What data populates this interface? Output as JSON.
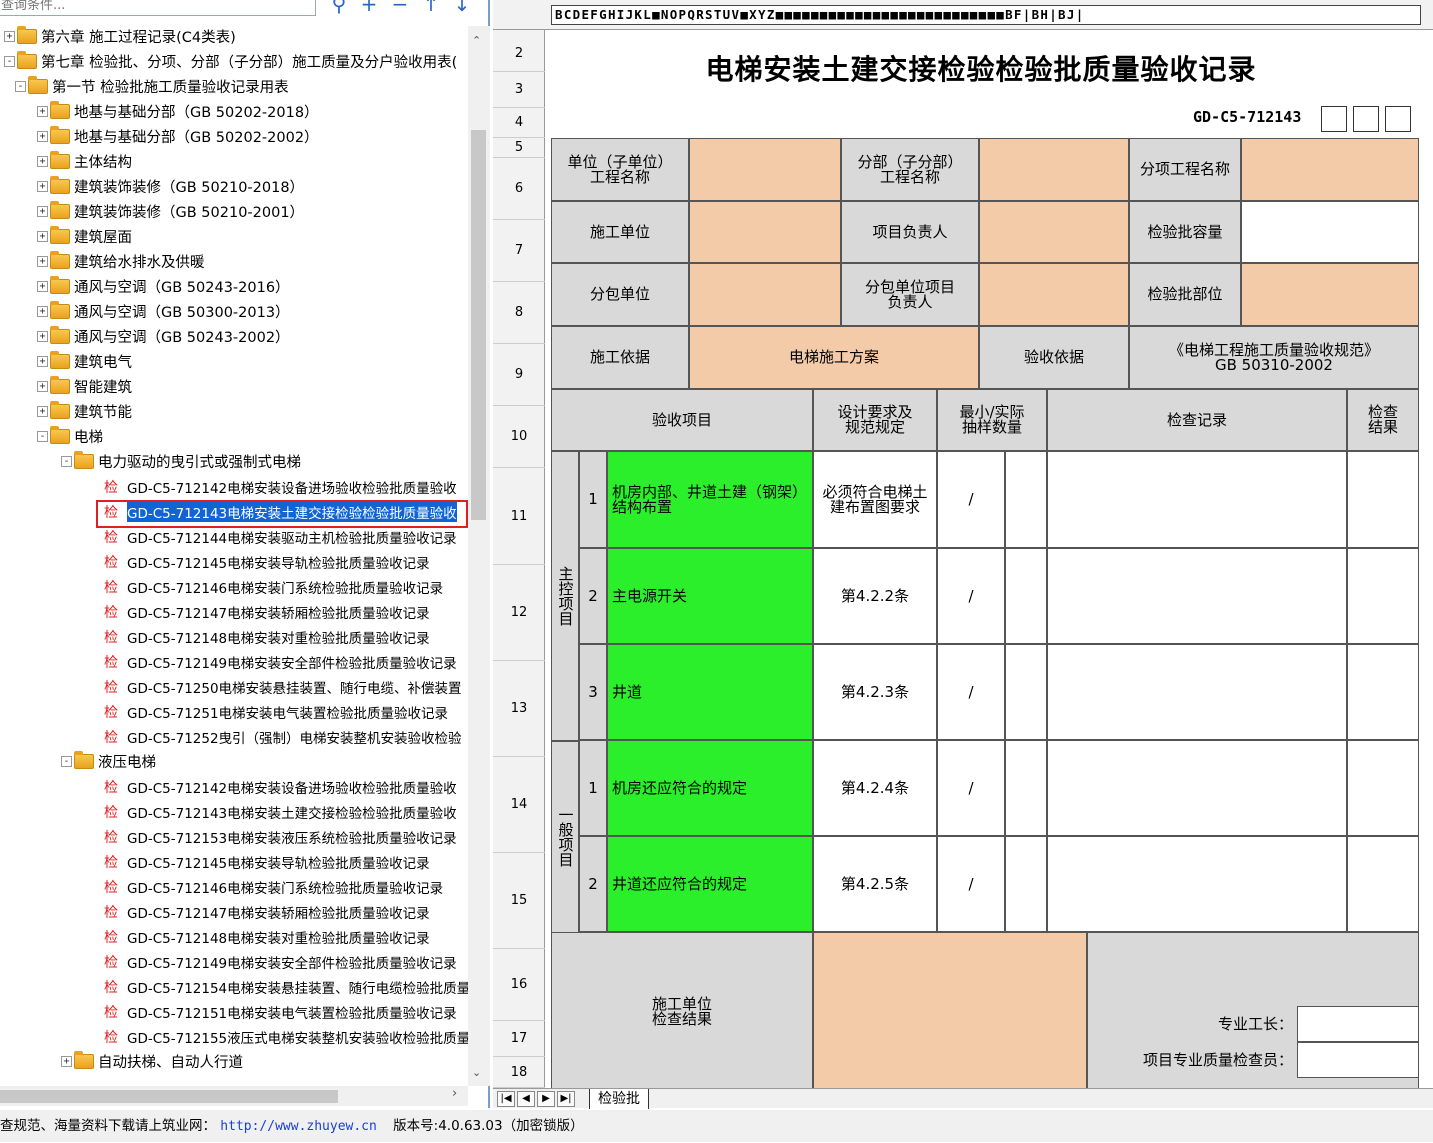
{
  "search": {
    "placeholder": "查询条件..."
  },
  "toolbar_icons": [
    "search-icon",
    "add-icon",
    "minus-icon",
    "arrow-up-icon",
    "arrow-down-icon"
  ],
  "tree": [
    {
      "label": "第六章  施工过程记录(C4类表)",
      "exp": "+",
      "lvl": 0
    },
    {
      "label": "第七章  检验批、分项、分部（子分部）施工质量及分户验收用表(",
      "exp": "-",
      "lvl": 0
    },
    {
      "label": "第一节  检验批施工质量验收记录用表",
      "exp": "-",
      "lvl": 1
    },
    {
      "label": "地基与基础分部（GB 50202-2018）",
      "exp": "+",
      "lvl": 2
    },
    {
      "label": "地基与基础分部（GB 50202-2002）",
      "exp": "+",
      "lvl": 2
    },
    {
      "label": "主体结构",
      "exp": "+",
      "lvl": 2
    },
    {
      "label": "建筑装饰装修（GB 50210-2018）",
      "exp": "+",
      "lvl": 2
    },
    {
      "label": "建筑装饰装修（GB 50210-2001）",
      "exp": "+",
      "lvl": 2
    },
    {
      "label": "建筑屋面",
      "exp": "+",
      "lvl": 2
    },
    {
      "label": "建筑给水排水及供暖",
      "exp": "+",
      "lvl": 2
    },
    {
      "label": "通风与空调（GB 50243-2016）",
      "exp": "+",
      "lvl": 2
    },
    {
      "label": "通风与空调（GB 50300-2013）",
      "exp": "+",
      "lvl": 2
    },
    {
      "label": "通风与空调（GB 50243-2002）",
      "exp": "+",
      "lvl": 2
    },
    {
      "label": "建筑电气",
      "exp": "+",
      "lvl": 2
    },
    {
      "label": "智能建筑",
      "exp": "+",
      "lvl": 2
    },
    {
      "label": "建筑节能",
      "exp": "+",
      "lvl": 2
    },
    {
      "label": "电梯",
      "exp": "-",
      "lvl": 2
    },
    {
      "label": "电力驱动的曳引式或强制式电梯",
      "exp": "-",
      "lvl": 3
    },
    {
      "label": "GD-C5-712142电梯安装设备进场验收检验批质量验收",
      "leaf": true
    },
    {
      "label": "GD-C5-712143电梯安装土建交接检验检验批质量验收",
      "leaf": true,
      "selected": true
    },
    {
      "label": "GD-C5-712144电梯安装驱动主机检验批质量验收记录",
      "leaf": true
    },
    {
      "label": "GD-C5-712145电梯安装导轨检验批质量验收记录",
      "leaf": true
    },
    {
      "label": "GD-C5-712146电梯安装门系统检验批质量验收记录",
      "leaf": true
    },
    {
      "label": "GD-C5-712147电梯安装轿厢检验批质量验收记录",
      "leaf": true
    },
    {
      "label": "GD-C5-712148电梯安装对重检验批质量验收记录",
      "leaf": true
    },
    {
      "label": "GD-C5-712149电梯安装安全部件检验批质量验收记录",
      "leaf": true
    },
    {
      "label": "GD-C5-71250电梯安装悬挂装置、随行电缆、补偿装置",
      "leaf": true
    },
    {
      "label": "GD-C5-71251电梯安装电气装置检验批质量验收记录",
      "leaf": true
    },
    {
      "label": "GD-C5-71252曳引（强制）电梯安装整机安装验收检验",
      "leaf": true
    },
    {
      "label": "液压电梯",
      "exp": "-",
      "lvl": 3
    },
    {
      "label": "GD-C5-712142电梯安装设备进场验收检验批质量验收",
      "leaf": true
    },
    {
      "label": "GD-C5-712143电梯安装土建交接检验检验批质量验收",
      "leaf": true
    },
    {
      "label": "GD-C5-712153电梯安装液压系统检验批质量验收记录",
      "leaf": true
    },
    {
      "label": "GD-C5-712145电梯安装导轨检验批质量验收记录",
      "leaf": true
    },
    {
      "label": "GD-C5-712146电梯安装门系统检验批质量验收记录",
      "leaf": true
    },
    {
      "label": "GD-C5-712147电梯安装轿厢检验批质量验收记录",
      "leaf": true
    },
    {
      "label": "GD-C5-712148电梯安装对重检验批质量验收记录",
      "leaf": true
    },
    {
      "label": "GD-C5-712149电梯安装安全部件检验批质量验收记录",
      "leaf": true
    },
    {
      "label": "GD-C5-712154电梯安装悬挂装置、随行电缆检验批质量",
      "leaf": true
    },
    {
      "label": "GD-C5-712151电梯安装电气装置检验批质量验收记录",
      "leaf": true
    },
    {
      "label": "GD-C5-712155液压式电梯安装整机安装验收检验批质量",
      "leaf": true
    },
    {
      "label": "自动扶梯、自动人行道",
      "exp": "+",
      "lvl": 3
    }
  ],
  "leaf_icon_text": "检",
  "sheet": {
    "col_letters": "BCDEFGHIJKL■NOPQRSTUV■XYZ■■■■■■■■■■■■■■■■■■■■■■■■■■BF|BH|BJ|",
    "row_numbers": [
      "2",
      "3",
      "4",
      "5",
      "6",
      "7",
      "8",
      "9",
      "10",
      "11",
      "12",
      "13",
      "14",
      "15",
      "16",
      "17",
      "18"
    ],
    "title": "电梯安装土建交接检验检验批质量验收记录",
    "code": "GD-C5-712143",
    "labels": {
      "unit_name": "单位（子单位）\n工程名称",
      "sub_part": "分部（子分部）\n工程名称",
      "item_name": "分项工程名称",
      "constructor": "施工单位",
      "project_leader": "项目负责人",
      "batch_capacity": "检验批容量",
      "subcontractor": "分包单位",
      "sub_leader": "分包单位项目\n负责人",
      "batch_location": "检验批部位",
      "basis": "施工依据",
      "basis_value": "电梯施工方案",
      "acceptance_basis": "验收依据",
      "acceptance_value": "《电梯工程施工质量验收规范》\nGB 50310-2002",
      "col_item": "验收项目",
      "col_design": "设计要求及\n规范规定",
      "col_sample": "最小/实际\n抽样数量",
      "col_record": "检查记录",
      "col_result": "检查\n结果",
      "main_items": "主控项目",
      "general_items": "一般项目",
      "check_result": "施工单位\n检查结果",
      "foreman": "专业工长：",
      "inspector": "项目专业质量检查员："
    },
    "items": [
      {
        "no": "1",
        "name": "机房内部、井道土建（钢架）结构布置",
        "spec": "必须符合电梯土建布置图要求",
        "sample": "/"
      },
      {
        "no": "2",
        "name": "主电源开关",
        "spec": "第4.2.2条",
        "sample": "/"
      },
      {
        "no": "3",
        "name": "井道",
        "spec": "第4.2.3条",
        "sample": "/"
      },
      {
        "no": "1",
        "name": "机房还应符合的规定",
        "spec": "第4.2.4条",
        "sample": "/"
      },
      {
        "no": "2",
        "name": "井道还应符合的规定",
        "spec": "第4.2.5条",
        "sample": "/"
      }
    ],
    "tab_name": "检验批"
  },
  "status": {
    "prefix": "查规范、海量资料下载请上筑业网：",
    "url": "http://www.zhuyew.cn",
    "version": "版本号:4.0.63.03（加密锁版）"
  },
  "colors": {
    "tan": "#f4cba8",
    "green": "#2aef2a",
    "selection": "#1064d4",
    "highlight_border": "#e02020"
  }
}
